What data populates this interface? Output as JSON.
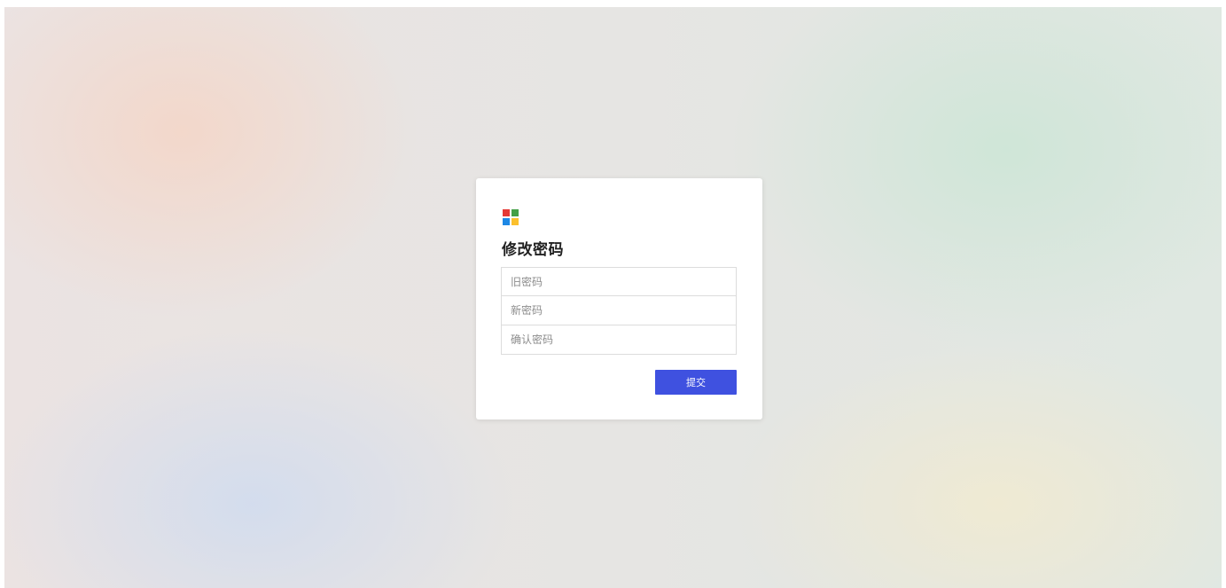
{
  "page": {
    "title": "修改密码"
  },
  "logo": {
    "icon": "four-square-logo-icon",
    "colors": [
      "#e53935",
      "#43a047",
      "#1e88e5",
      "#fbc02d"
    ]
  },
  "form": {
    "old_password": {
      "placeholder": "旧密码",
      "value": ""
    },
    "new_password": {
      "placeholder": "新密码",
      "value": ""
    },
    "confirm_password": {
      "placeholder": "确认密码",
      "value": ""
    },
    "submit_label": "提交"
  },
  "colors": {
    "accent": "#3f51e0",
    "card_background": "#ffffff"
  }
}
